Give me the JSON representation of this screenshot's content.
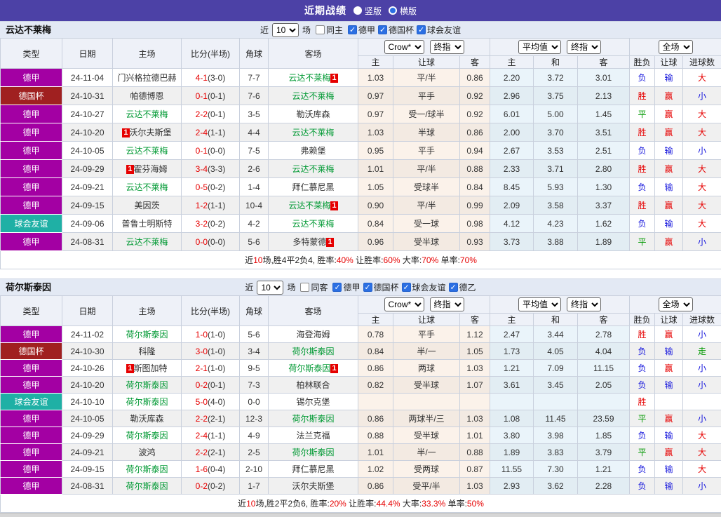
{
  "header": {
    "title": "近期战绩",
    "vertical_label": "竖版",
    "horizontal_label": "横版"
  },
  "filter_labels": {
    "near": "近",
    "games": "场"
  },
  "selects": {
    "crow": "Crow*",
    "final1": "终指",
    "avg": "平均值",
    "final2": "终指",
    "full": "全场"
  },
  "table_columns": {
    "type": "类型",
    "date": "日期",
    "home": "主场",
    "score": "比分(半场)",
    "corner": "角球",
    "away": "客场",
    "sub": [
      "主",
      "让球",
      "客",
      "主",
      "和",
      "客",
      "胜负",
      "让球",
      "进球数"
    ]
  },
  "colors": {
    "type_colors": {
      "德甲": "#A300A3",
      "德国杯": "#A02020",
      "球会友谊": "#1FB0A5"
    },
    "result_colors": {
      "胜": "#E60000",
      "平": "#009900",
      "负": "#1414DC",
      "赢": "#E60000",
      "输": "#1414DC",
      "走": "#009900",
      "大": "#E60000",
      "小": "#1414DC"
    },
    "team_green": "#009933"
  },
  "sections": [
    {
      "team": "云达不莱梅",
      "filter": {
        "count": "10",
        "same_label": "同主",
        "leagues": [
          "德甲",
          "德国杯",
          "球会友谊"
        ]
      },
      "rows": [
        {
          "league": "德甲",
          "date": "24-11-04",
          "home": "门兴格拉德巴赫",
          "home_green": false,
          "home_badge": "",
          "score": "4-1",
          "half": "(3-0)",
          "corner": "7-7",
          "away": "云达不莱梅",
          "away_green": true,
          "away_badge": "1",
          "odds": [
            "1.03",
            "平/半",
            "0.86"
          ],
          "avg": [
            "2.20",
            "3.72",
            "3.01"
          ],
          "result": [
            "负",
            "输",
            "大"
          ]
        },
        {
          "league": "德国杯",
          "date": "24-10-31",
          "home": "帕德博恩",
          "home_green": false,
          "home_badge": "",
          "score": "0-1",
          "half": "(0-1)",
          "corner": "7-6",
          "away": "云达不莱梅",
          "away_green": true,
          "away_badge": "",
          "odds": [
            "0.97",
            "平手",
            "0.92"
          ],
          "avg": [
            "2.96",
            "3.75",
            "2.13"
          ],
          "result": [
            "胜",
            "赢",
            "小"
          ]
        },
        {
          "league": "德甲",
          "date": "24-10-27",
          "home": "云达不莱梅",
          "home_green": true,
          "home_badge": "",
          "score": "2-2",
          "half": "(0-1)",
          "corner": "3-5",
          "away": "勒沃库森",
          "away_green": false,
          "away_badge": "",
          "odds": [
            "0.97",
            "受一/球半",
            "0.92"
          ],
          "avg": [
            "6.01",
            "5.00",
            "1.45"
          ],
          "result": [
            "平",
            "赢",
            "大"
          ]
        },
        {
          "league": "德甲",
          "date": "24-10-20",
          "home": "沃尔夫斯堡",
          "home_green": false,
          "home_badge": "1",
          "score": "2-4",
          "half": "(1-1)",
          "corner": "4-4",
          "away": "云达不莱梅",
          "away_green": true,
          "away_badge": "",
          "odds": [
            "1.03",
            "半球",
            "0.86"
          ],
          "avg": [
            "2.00",
            "3.70",
            "3.51"
          ],
          "result": [
            "胜",
            "赢",
            "大"
          ]
        },
        {
          "league": "德甲",
          "date": "24-10-05",
          "home": "云达不莱梅",
          "home_green": true,
          "home_badge": "",
          "score": "0-1",
          "half": "(0-0)",
          "corner": "7-5",
          "away": "弗赖堡",
          "away_green": false,
          "away_badge": "",
          "odds": [
            "0.95",
            "平手",
            "0.94"
          ],
          "avg": [
            "2.67",
            "3.53",
            "2.51"
          ],
          "result": [
            "负",
            "输",
            "小"
          ]
        },
        {
          "league": "德甲",
          "date": "24-09-29",
          "home": "霍芬海姆",
          "home_green": false,
          "home_badge": "1",
          "score": "3-4",
          "half": "(3-3)",
          "corner": "2-6",
          "away": "云达不莱梅",
          "away_green": true,
          "away_badge": "",
          "odds": [
            "1.01",
            "平/半",
            "0.88"
          ],
          "avg": [
            "2.33",
            "3.71",
            "2.80"
          ],
          "result": [
            "胜",
            "赢",
            "大"
          ]
        },
        {
          "league": "德甲",
          "date": "24-09-21",
          "home": "云达不莱梅",
          "home_green": true,
          "home_badge": "",
          "score": "0-5",
          "half": "(0-2)",
          "corner": "1-4",
          "away": "拜仁慕尼黑",
          "away_green": false,
          "away_badge": "",
          "odds": [
            "1.05",
            "受球半",
            "0.84"
          ],
          "avg": [
            "8.45",
            "5.93",
            "1.30"
          ],
          "result": [
            "负",
            "输",
            "大"
          ]
        },
        {
          "league": "德甲",
          "date": "24-09-15",
          "home": "美因茨",
          "home_green": false,
          "home_badge": "",
          "score": "1-2",
          "half": "(1-1)",
          "corner": "10-4",
          "away": "云达不莱梅",
          "away_green": true,
          "away_badge": "1",
          "odds": [
            "0.90",
            "平/半",
            "0.99"
          ],
          "avg": [
            "2.09",
            "3.58",
            "3.37"
          ],
          "result": [
            "胜",
            "赢",
            "大"
          ]
        },
        {
          "league": "球会友谊",
          "date": "24-09-06",
          "home": "普鲁士明斯特",
          "home_green": false,
          "home_badge": "",
          "score": "3-2",
          "half": "(0-2)",
          "corner": "4-2",
          "away": "云达不莱梅",
          "away_green": true,
          "away_badge": "",
          "odds": [
            "0.84",
            "受一球",
            "0.98"
          ],
          "avg": [
            "4.12",
            "4.23",
            "1.62"
          ],
          "result": [
            "负",
            "输",
            "大"
          ]
        },
        {
          "league": "德甲",
          "date": "24-08-31",
          "home": "云达不莱梅",
          "home_green": true,
          "home_badge": "",
          "score": "0-0",
          "half": "(0-0)",
          "corner": "5-6",
          "away": "多特蒙德",
          "away_green": false,
          "away_badge": "1",
          "odds": [
            "0.96",
            "受半球",
            "0.93"
          ],
          "avg": [
            "3.73",
            "3.88",
            "1.89"
          ],
          "result": [
            "平",
            "赢",
            "小"
          ]
        }
      ],
      "summary": [
        {
          "t": "近",
          "r": false
        },
        {
          "t": "10",
          "r": true
        },
        {
          "t": "场,胜4平2负4, 胜率:",
          "r": false
        },
        {
          "t": "40%",
          "r": true
        },
        {
          "t": " 让胜率:",
          "r": false
        },
        {
          "t": "60%",
          "r": true
        },
        {
          "t": " 大率:",
          "r": false
        },
        {
          "t": "70%",
          "r": true
        },
        {
          "t": " 单率:",
          "r": false
        },
        {
          "t": "70%",
          "r": true
        }
      ]
    },
    {
      "team": "荷尔斯泰因",
      "filter": {
        "count": "10",
        "same_label": "同客",
        "leagues": [
          "德甲",
          "德国杯",
          "球会友谊",
          "德乙"
        ]
      },
      "rows": [
        {
          "league": "德甲",
          "date": "24-11-02",
          "home": "荷尔斯泰因",
          "home_green": true,
          "home_badge": "",
          "score": "1-0",
          "half": "(1-0)",
          "corner": "5-6",
          "away": "海登海姆",
          "away_green": false,
          "away_badge": "",
          "odds": [
            "0.78",
            "平手",
            "1.12"
          ],
          "avg": [
            "2.47",
            "3.44",
            "2.78"
          ],
          "result": [
            "胜",
            "赢",
            "小"
          ]
        },
        {
          "league": "德国杯",
          "date": "24-10-30",
          "home": "科隆",
          "home_green": false,
          "home_badge": "",
          "score": "3-0",
          "half": "(1-0)",
          "corner": "3-4",
          "away": "荷尔斯泰因",
          "away_green": true,
          "away_badge": "",
          "odds": [
            "0.84",
            "半/一",
            "1.05"
          ],
          "avg": [
            "1.73",
            "4.05",
            "4.04"
          ],
          "result": [
            "负",
            "输",
            "走"
          ]
        },
        {
          "league": "德甲",
          "date": "24-10-26",
          "home": "斯图加特",
          "home_green": false,
          "home_badge": "1",
          "score": "2-1",
          "half": "(1-0)",
          "corner": "9-5",
          "away": "荷尔斯泰因",
          "away_green": true,
          "away_badge": "1",
          "odds": [
            "0.86",
            "两球",
            "1.03"
          ],
          "avg": [
            "1.21",
            "7.09",
            "11.15"
          ],
          "result": [
            "负",
            "赢",
            "小"
          ]
        },
        {
          "league": "德甲",
          "date": "24-10-20",
          "home": "荷尔斯泰因",
          "home_green": true,
          "home_badge": "",
          "score": "0-2",
          "half": "(0-1)",
          "corner": "7-3",
          "away": "柏林联合",
          "away_green": false,
          "away_badge": "",
          "odds": [
            "0.82",
            "受半球",
            "1.07"
          ],
          "avg": [
            "3.61",
            "3.45",
            "2.05"
          ],
          "result": [
            "负",
            "输",
            "小"
          ]
        },
        {
          "league": "球会友谊",
          "date": "24-10-10",
          "home": "荷尔斯泰因",
          "home_green": true,
          "home_badge": "",
          "score": "5-0",
          "half": "(4-0)",
          "corner": "0-0",
          "away": "锡尔克堡",
          "away_green": false,
          "away_badge": "",
          "odds": [
            "",
            "",
            ""
          ],
          "avg": [
            "",
            "",
            ""
          ],
          "result": [
            "胜",
            "",
            ""
          ]
        },
        {
          "league": "德甲",
          "date": "24-10-05",
          "home": "勒沃库森",
          "home_green": false,
          "home_badge": "",
          "score": "2-2",
          "half": "(2-1)",
          "corner": "12-3",
          "away": "荷尔斯泰因",
          "away_green": true,
          "away_badge": "",
          "odds": [
            "0.86",
            "两球半/三",
            "1.03"
          ],
          "avg": [
            "1.08",
            "11.45",
            "23.59"
          ],
          "result": [
            "平",
            "赢",
            "小"
          ]
        },
        {
          "league": "德甲",
          "date": "24-09-29",
          "home": "荷尔斯泰因",
          "home_green": true,
          "home_badge": "",
          "score": "2-4",
          "half": "(1-1)",
          "corner": "4-9",
          "away": "法兰克福",
          "away_green": false,
          "away_badge": "",
          "odds": [
            "0.88",
            "受半球",
            "1.01"
          ],
          "avg": [
            "3.80",
            "3.98",
            "1.85"
          ],
          "result": [
            "负",
            "输",
            "大"
          ]
        },
        {
          "league": "德甲",
          "date": "24-09-21",
          "home": "波鸿",
          "home_green": false,
          "home_badge": "",
          "score": "2-2",
          "half": "(2-1)",
          "corner": "2-5",
          "away": "荷尔斯泰因",
          "away_green": true,
          "away_badge": "",
          "odds": [
            "1.01",
            "半/一",
            "0.88"
          ],
          "avg": [
            "1.89",
            "3.83",
            "3.79"
          ],
          "result": [
            "平",
            "赢",
            "大"
          ]
        },
        {
          "league": "德甲",
          "date": "24-09-15",
          "home": "荷尔斯泰因",
          "home_green": true,
          "home_badge": "",
          "score": "1-6",
          "half": "(0-4)",
          "corner": "2-10",
          "away": "拜仁慕尼黑",
          "away_green": false,
          "away_badge": "",
          "odds": [
            "1.02",
            "受两球",
            "0.87"
          ],
          "avg": [
            "11.55",
            "7.30",
            "1.21"
          ],
          "result": [
            "负",
            "输",
            "大"
          ]
        },
        {
          "league": "德甲",
          "date": "24-08-31",
          "home": "荷尔斯泰因",
          "home_green": true,
          "home_badge": "",
          "score": "0-2",
          "half": "(0-2)",
          "corner": "1-7",
          "away": "沃尔夫斯堡",
          "away_green": false,
          "away_badge": "",
          "odds": [
            "0.86",
            "受平/半",
            "1.03"
          ],
          "avg": [
            "2.93",
            "3.62",
            "2.28"
          ],
          "result": [
            "负",
            "输",
            "小"
          ]
        }
      ],
      "summary": [
        {
          "t": "近",
          "r": false
        },
        {
          "t": "10",
          "r": true
        },
        {
          "t": "场,胜2平2负6, 胜率:",
          "r": false
        },
        {
          "t": "20%",
          "r": true
        },
        {
          "t": " 让胜率:",
          "r": false
        },
        {
          "t": "44.4%",
          "r": true
        },
        {
          "t": " 大率:",
          "r": false
        },
        {
          "t": "33.3%",
          "r": true
        },
        {
          "t": " 单率:",
          "r": false
        },
        {
          "t": "50%",
          "r": true
        }
      ]
    }
  ]
}
